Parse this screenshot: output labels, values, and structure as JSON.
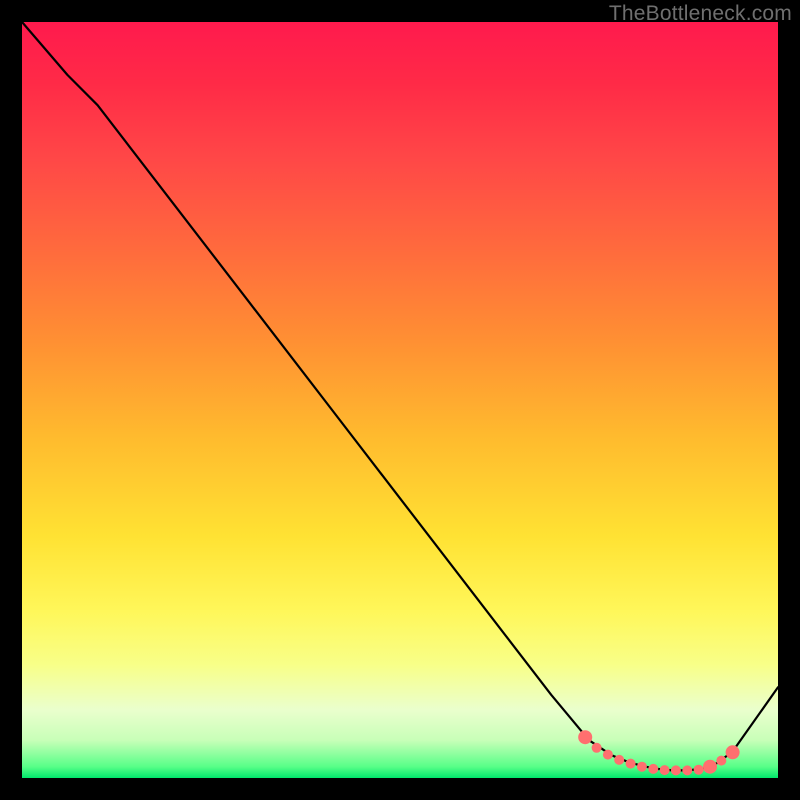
{
  "watermark": "TheBottleneck.com",
  "chart_data": {
    "type": "line",
    "title": "",
    "xlabel": "",
    "ylabel": "",
    "xlim": [
      0,
      100
    ],
    "ylim": [
      0,
      100
    ],
    "grid": false,
    "series": [
      {
        "name": "curve",
        "color": "#000000",
        "x": [
          0,
          6,
          10,
          20,
          30,
          40,
          50,
          60,
          70,
          75,
          78,
          80,
          82,
          84,
          86,
          88,
          90,
          92,
          94,
          100
        ],
        "y": [
          100,
          93,
          89,
          76,
          63,
          50,
          37,
          24,
          11,
          5,
          3,
          2.2,
          1.6,
          1.2,
          1.0,
          1.0,
          1.2,
          2.0,
          3.5,
          12
        ]
      }
    ],
    "markers": {
      "name": "highlight-dots",
      "color": "#ff6f6f",
      "radius_small": 5,
      "radius_large": 7,
      "points": [
        {
          "x": 74.5,
          "y": 5.4,
          "r": 7
        },
        {
          "x": 76,
          "y": 4.0,
          "r": 5
        },
        {
          "x": 77.5,
          "y": 3.1,
          "r": 5
        },
        {
          "x": 79,
          "y": 2.4,
          "r": 5
        },
        {
          "x": 80.5,
          "y": 1.9,
          "r": 5
        },
        {
          "x": 82,
          "y": 1.5,
          "r": 5
        },
        {
          "x": 83.5,
          "y": 1.2,
          "r": 5
        },
        {
          "x": 85,
          "y": 1.05,
          "r": 5
        },
        {
          "x": 86.5,
          "y": 1.0,
          "r": 5
        },
        {
          "x": 88,
          "y": 1.0,
          "r": 5
        },
        {
          "x": 89.5,
          "y": 1.1,
          "r": 5
        },
        {
          "x": 91,
          "y": 1.5,
          "r": 7
        },
        {
          "x": 92.5,
          "y": 2.3,
          "r": 5
        },
        {
          "x": 94,
          "y": 3.4,
          "r": 7
        }
      ]
    }
  }
}
